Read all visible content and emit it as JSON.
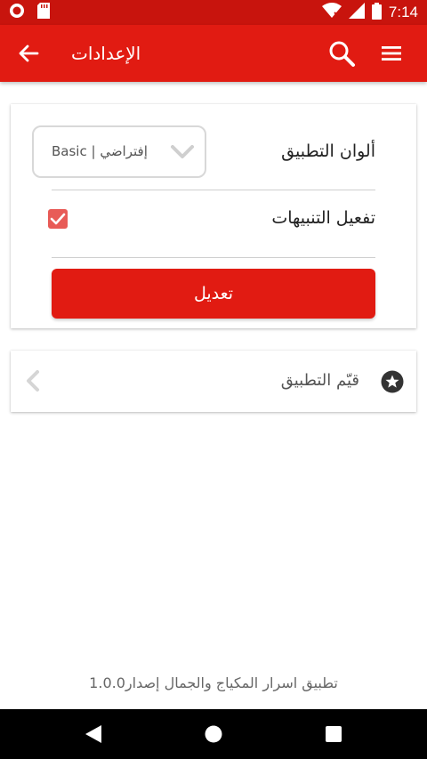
{
  "status_bar": {
    "time": "7:14",
    "icons": [
      "notification-dot-icon",
      "sd-card-icon",
      "wifi-icon",
      "signal-icon",
      "battery-icon"
    ]
  },
  "app_bar": {
    "title": "الإعدادات",
    "icons": [
      "back-arrow-icon",
      "search-icon",
      "menu-icon"
    ],
    "color": "#e11b12"
  },
  "settings": {
    "app_colors_label": "ألوان التطبيق",
    "app_colors_value": "Basic | إفتراضي",
    "notifications_label": "تفعيل التنبيهات",
    "notifications_enabled": true,
    "submit_label": "تعديل"
  },
  "rate": {
    "label": "قيّم التطبيق",
    "icon": "star-icon"
  },
  "footer": {
    "version_text": "تطبيق اسرار المكياج والجمال إصدار1.0.0"
  },
  "nav_bar": {
    "icons": [
      "nav-back-icon",
      "nav-home-icon",
      "nav-recents-icon"
    ]
  }
}
